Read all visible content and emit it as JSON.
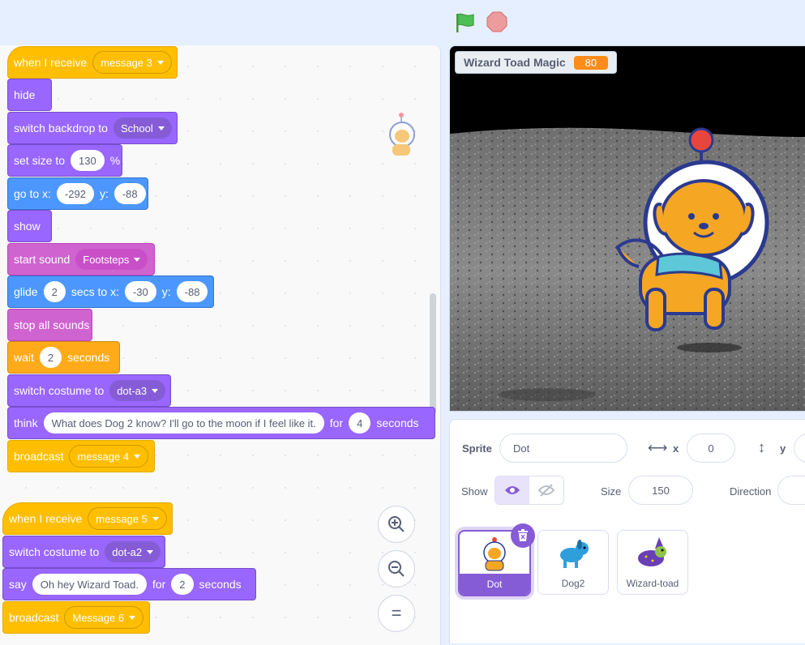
{
  "toolbar": {
    "green_flag": "green-flag-icon",
    "stop": "stop-icon"
  },
  "script1": {
    "hat": {
      "label": "when I receive",
      "message": "message 3"
    },
    "hide": "hide",
    "switch_backdrop": {
      "label": "switch backdrop to",
      "value": "School"
    },
    "set_size": {
      "label": "set size to",
      "value": "130",
      "unit": "%"
    },
    "go_to": {
      "label": "go to x:",
      "x": "-292",
      "y_label": "y:",
      "y": "-88"
    },
    "show": "show",
    "start_sound": {
      "label": "start sound",
      "value": "Footsteps"
    },
    "glide": {
      "label": "glide",
      "secs": "2",
      "mid": "secs to x:",
      "x": "-30",
      "y_label": "y:",
      "y": "-88"
    },
    "stop_sounds": "stop all sounds",
    "wait": {
      "label": "wait",
      "value": "2",
      "unit": "seconds"
    },
    "switch_costume": {
      "label": "switch costume to",
      "value": "dot-a3"
    },
    "think": {
      "label": "think",
      "text": "What does Dog 2 know? I'll go to the moon if I feel like it.",
      "for": "for",
      "secs": "4",
      "unit": "seconds"
    },
    "broadcast": {
      "label": "broadcast",
      "value": "message 4"
    }
  },
  "script2": {
    "hat": {
      "label": "when I receive",
      "message": "message 5"
    },
    "switch_costume": {
      "label": "switch costume to",
      "value": "dot-a2"
    },
    "say": {
      "label": "say",
      "text": "Oh hey Wizard Toad.",
      "for": "for",
      "secs": "2",
      "unit": "seconds"
    },
    "broadcast": {
      "label": "broadcast",
      "value": "Message 6"
    }
  },
  "zoom": {
    "in": "+",
    "out": "−",
    "reset": "="
  },
  "stage": {
    "monitor_label": "Wizard Toad Magic",
    "monitor_value": "80"
  },
  "sprite_info": {
    "sprite_label": "Sprite",
    "sprite_name": "Dot",
    "x_label": "x",
    "x_value": "0",
    "y_label": "y",
    "show_label": "Show",
    "size_label": "Size",
    "size_value": "150",
    "direction_label": "Direction"
  },
  "sprites": [
    {
      "name": "Dot",
      "selected": true
    },
    {
      "name": "Dog2",
      "selected": false
    },
    {
      "name": "Wizard-toad",
      "selected": false
    }
  ]
}
